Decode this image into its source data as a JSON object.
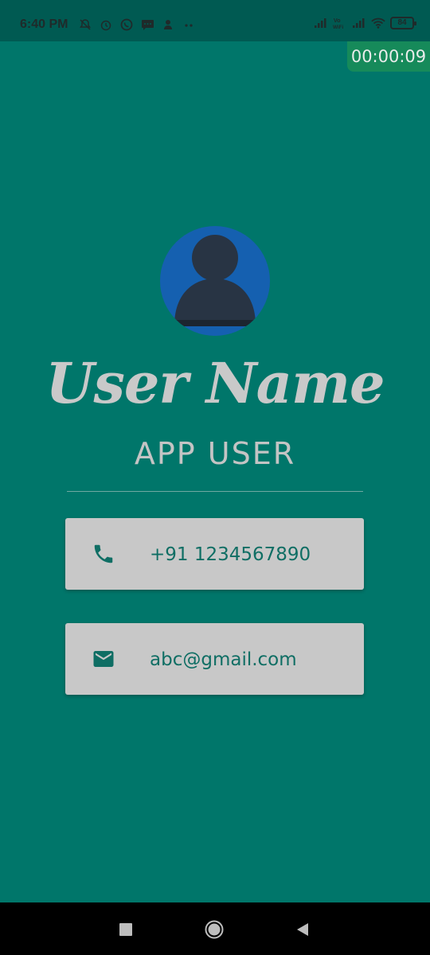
{
  "status_bar": {
    "time": "6:40 PM",
    "battery": "84",
    "icons_left": [
      "mute-bell-icon",
      "alarm-icon",
      "whatsapp-icon",
      "message-icon",
      "account-icon",
      "more-dots-icon"
    ],
    "icons_right": [
      "signal-icon",
      "volte-wifi-icon",
      "signal-icon",
      "wifi-icon",
      "battery-icon"
    ]
  },
  "timer": {
    "value": "00:00:09"
  },
  "profile": {
    "avatar_icon": "person-icon",
    "name": "User Name",
    "role": "APP USER"
  },
  "contact": {
    "phone": {
      "icon": "phone-icon",
      "value": "+91 1234567890"
    },
    "email": {
      "icon": "mail-icon",
      "value": "abc@gmail.com"
    }
  },
  "colors": {
    "background": "#00766a",
    "status_bar": "#005a52",
    "card": "#c8c8c8",
    "accent": "#0f6e64",
    "avatar_bg": "#1560b0"
  },
  "nav_bar": {
    "buttons": [
      "recent-apps-icon",
      "home-icon",
      "back-icon"
    ]
  }
}
